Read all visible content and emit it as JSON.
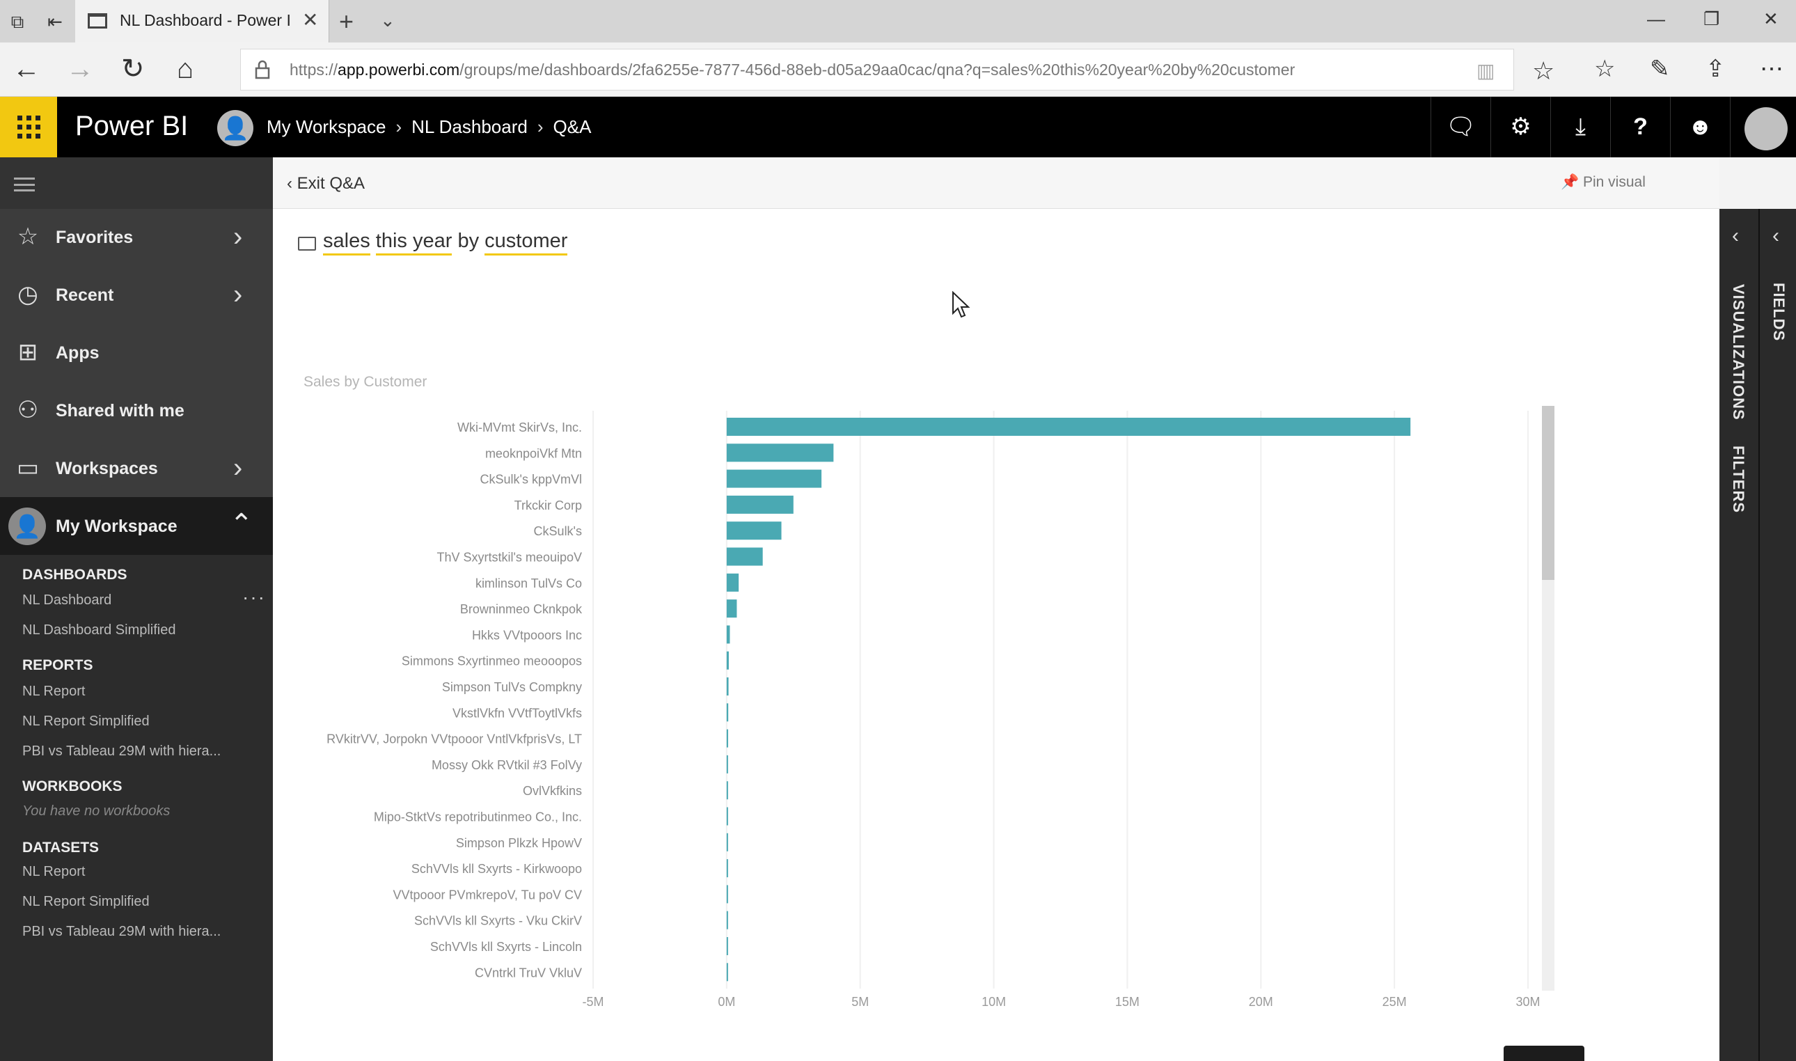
{
  "browser": {
    "tab_title": "NL Dashboard - Power I",
    "url_prefix": "https://",
    "url_host": "app.powerbi.com",
    "url_path": "/groups/me/dashboards/2fa6255e-7877-456d-88eb-d05a29aa0cac/qna?q=sales%20this%20year%20by%20customer"
  },
  "header": {
    "brand": "Power BI",
    "breadcrumbs": [
      "My Workspace",
      "NL Dashboard",
      "Q&A"
    ]
  },
  "nav": {
    "items": [
      {
        "label": "Favorites",
        "icon": "star-icon"
      },
      {
        "label": "Recent",
        "icon": "clock-icon"
      },
      {
        "label": "Apps",
        "icon": "apps-icon"
      },
      {
        "label": "Shared with me",
        "icon": "shared-icon"
      },
      {
        "label": "Workspaces",
        "icon": "workspaces-icon"
      }
    ],
    "my_workspace": "My Workspace",
    "sections": {
      "dashboards": {
        "title": "DASHBOARDS",
        "items": [
          "NL Dashboard",
          "NL Dashboard Simplified"
        ]
      },
      "reports": {
        "title": "REPORTS",
        "items": [
          "NL Report",
          "NL Report Simplified",
          "PBI vs Tableau 29M with hiera..."
        ]
      },
      "workbooks": {
        "title": "WORKBOOKS",
        "empty": "You have no workbooks"
      },
      "datasets": {
        "title": "DATASETS",
        "items": [
          "NL Report",
          "NL Report Simplified",
          "PBI vs Tableau 29M with hiera..."
        ]
      }
    }
  },
  "qna": {
    "exit_label": "Exit Q&A",
    "pin_label": "Pin visual",
    "question_terms": [
      "sales",
      "this year",
      "by",
      "customer"
    ]
  },
  "panes": {
    "visualizations": "VISUALIZATIONS",
    "filters": "FILTERS",
    "fields": "FIELDS"
  },
  "colors": {
    "accent": "#f2c811",
    "bar": "#4aa9b3"
  },
  "chart_data": {
    "type": "bar",
    "orientation": "horizontal",
    "title": "Sales by Customer",
    "categories": [
      "Wki-MVmt SkirVs, Inc.",
      "meoknpoiVkf Mtn",
      "CkSulk's kppVmVl",
      "Trkckir Corp",
      "CkSulk's",
      "ThV Sxyrtstkil's meouipoV",
      "kimlinson TulVs Co",
      "Browninmeo Cknkpok",
      "Hkks VVtpooors Inc",
      "Simmons Sxyrtinmeo meooopos",
      "Simpson TulVs Compkny",
      "VkstlVkfn VVtfToytlVkfs",
      "RVkitrVV, Jorpokn VVtpooor VntlVkfprisVs, LT",
      "Mossy Okk RVtkil #3 FolVy",
      "OvlVkfkins",
      "Mipo-StktVs repotributinmeo Co., Inc.",
      "Simpson Plkzk HpowV",
      "SchVVls kll Sxyrts - Kirkwoopo",
      "VVtpooor PVmkrepoV, Tu poV CV",
      "SchVVls kll Sxyrts - Vku CkirV",
      "SchVVls kll Sxyrts - Lincoln",
      "CVntrkl TruV VkluV"
    ],
    "values": [
      25600000,
      4000000,
      3550000,
      2500000,
      2050000,
      1350000,
      450000,
      380000,
      120000,
      80000,
      70000,
      60000,
      55000,
      50000,
      45000,
      40000,
      35000,
      30000,
      28000,
      25000,
      22000,
      20000
    ],
    "xlim": [
      -5000000,
      30000000
    ],
    "xticks": [
      -5000000,
      0,
      5000000,
      10000000,
      15000000,
      20000000,
      25000000,
      30000000
    ],
    "xtick_labels": [
      "-5M",
      "0M",
      "5M",
      "10M",
      "15M",
      "20M",
      "25M",
      "30M"
    ],
    "grid": true
  }
}
